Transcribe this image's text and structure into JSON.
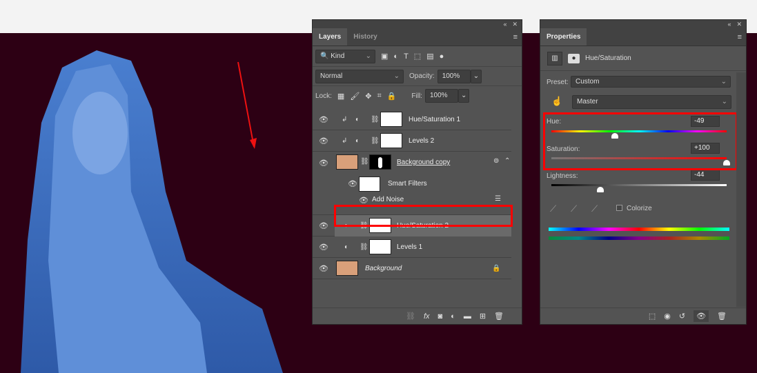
{
  "layers_panel": {
    "tabs": [
      {
        "label": "Layers",
        "active": true
      },
      {
        "label": "History",
        "active": false
      }
    ],
    "filter": {
      "value": "Kind"
    },
    "blend_mode": "Normal",
    "opacity_label": "Opacity:",
    "opacity": "100%",
    "lock_label": "Lock:",
    "fill_label": "Fill:",
    "fill": "100%",
    "layers": [
      {
        "name": "Hue/Saturation 1",
        "type": "adjustment",
        "clipped": true
      },
      {
        "name": "Levels 2",
        "type": "adjustment",
        "clipped": true
      },
      {
        "name": "Background copy",
        "type": "smart-object"
      },
      {
        "name": "Smart Filters",
        "type": "smart-filters"
      },
      {
        "name": "Add Noise",
        "type": "filter"
      },
      {
        "name": "Hue/Saturation 2",
        "type": "adjustment",
        "selected": true
      },
      {
        "name": "Levels 1",
        "type": "adjustment"
      },
      {
        "name": "Background",
        "type": "background",
        "locked": true
      }
    ]
  },
  "properties_panel": {
    "tab": "Properties",
    "adjustment_title": "Hue/Saturation",
    "preset_label": "Preset:",
    "preset": "Custom",
    "channel": "Master",
    "hue_label": "Hue:",
    "hue": "-49",
    "saturation_label": "Saturation:",
    "saturation": "+100",
    "lightness_label": "Lightness:",
    "lightness": "-44",
    "colorize_label": "Colorize",
    "colorize": false
  },
  "colors": {
    "highlight": "#ff0000",
    "canvas": "#2d0014",
    "panel": "#535353",
    "photo_tint": "#3a6fc4"
  }
}
